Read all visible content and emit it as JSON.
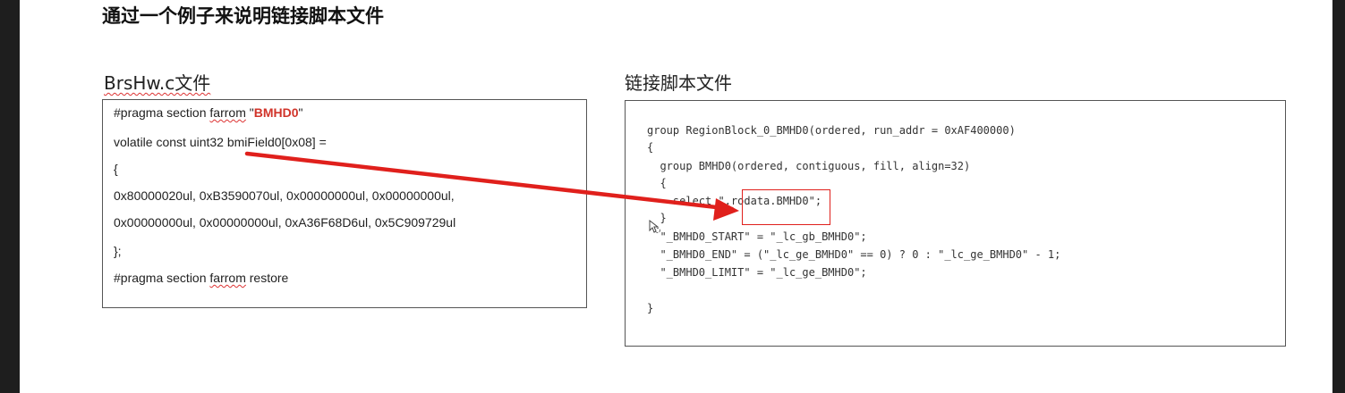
{
  "title": "通过一个例子来说明链接脚本文件",
  "left_panel": {
    "label": "BrsHw.c文件",
    "lines": {
      "l1_pre": "#pragma section ",
      "l1_farrom": "farrom",
      "l1_q1": " \"",
      "l1_name": "BMHD0",
      "l1_q2": "\"",
      "l2": "volatile const uint32 bmiField0[0x08] =",
      "l3": "{",
      "l4": " 0x80000020ul, 0xB3590070ul, 0x00000000ul, 0x00000000ul,",
      "l5": " 0x00000000ul, 0x00000000ul, 0xA36F68D6ul, 0x5C909729ul",
      "l6": "};",
      "l7_pre": "#pragma section ",
      "l7_farrom": "farrom",
      "l7_post": " restore"
    }
  },
  "right_panel": {
    "label": "链接脚本文件",
    "lines": [
      "group RegionBlock_0_BMHD0(ordered, run_addr = 0xAF400000)",
      "{",
      "  group BMHD0(ordered, contiguous, fill, align=32)",
      "  {",
      "    select \".rodata.BMHD0\";",
      "  }",
      "  \"_BMHD0_START\" = \"_lc_gb_BMHD0\";",
      "  \"_BMHD0_END\" = (\"_lc_ge_BMHD0\" == 0) ? 0 : \"_lc_ge_BMHD0\" - 1;",
      "  \"_BMHD0_LIMIT\" = \"_lc_ge_BMHD0\";",
      "",
      "}"
    ]
  },
  "colors": {
    "accent_red": "#e0201c",
    "frame_dark": "#1e1e1e"
  },
  "icons": {
    "cursor": "loading-cursor-icon"
  }
}
